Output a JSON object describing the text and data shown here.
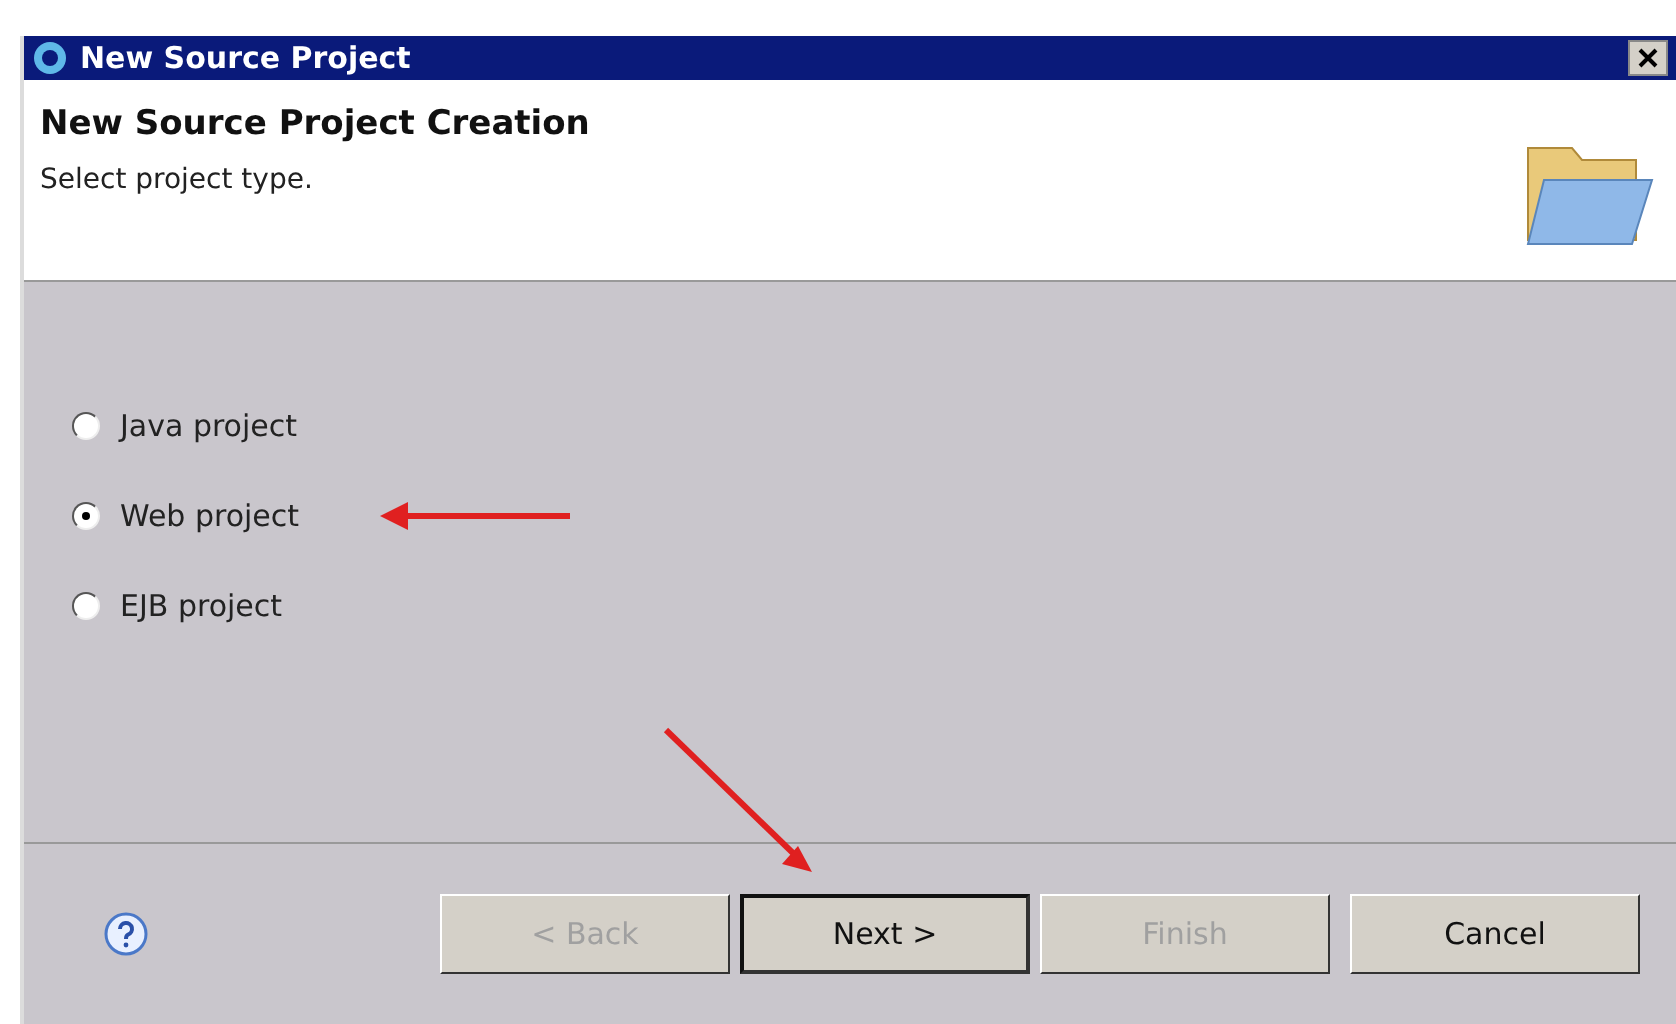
{
  "window": {
    "title": "New Source Project"
  },
  "header": {
    "title": "New Source Project Creation",
    "subtitle": "Select project type."
  },
  "options": [
    {
      "label": "Java project",
      "selected": false
    },
    {
      "label": "Web project",
      "selected": true
    },
    {
      "label": "EJB project",
      "selected": false
    }
  ],
  "buttons": [
    {
      "label": "< Back",
      "disabled": true,
      "default": false
    },
    {
      "label": "Next >",
      "disabled": false,
      "default": true
    },
    {
      "label": "Finish",
      "disabled": true,
      "default": false
    },
    {
      "label": "Cancel",
      "disabled": false,
      "default": false
    }
  ]
}
